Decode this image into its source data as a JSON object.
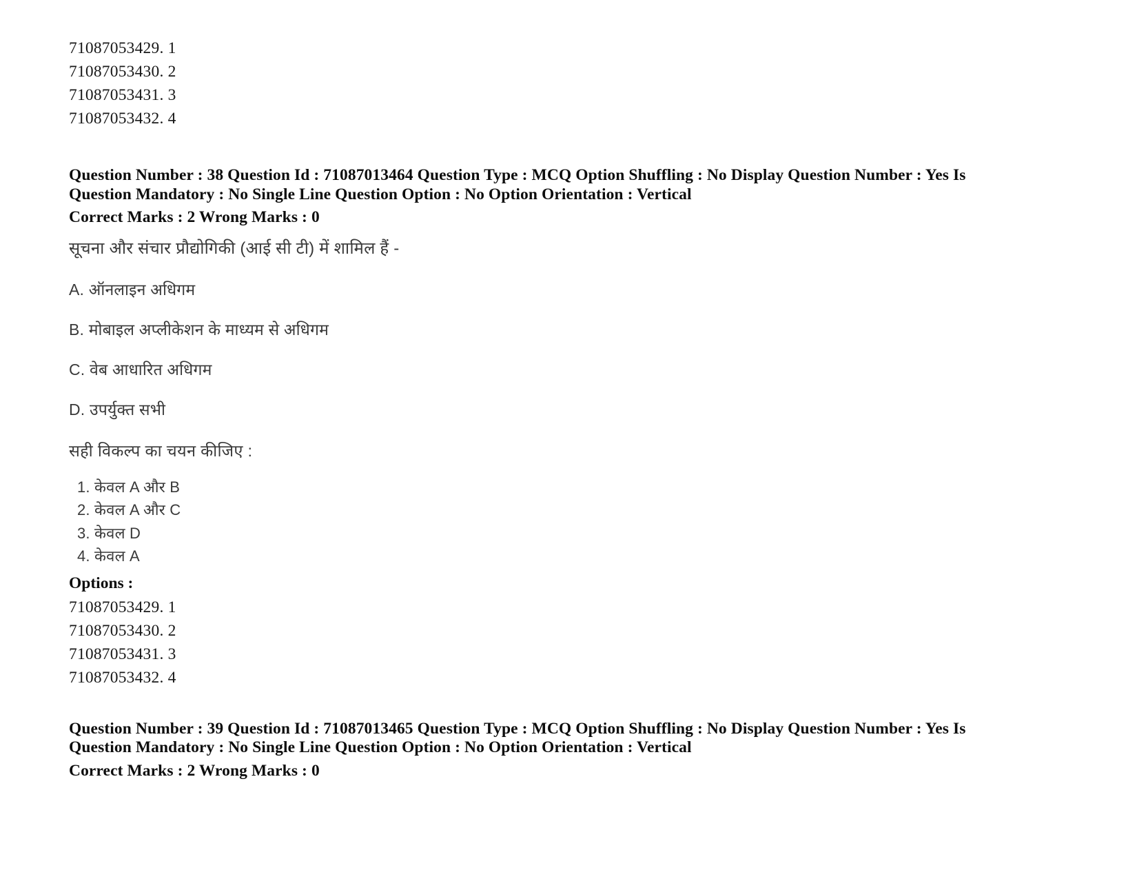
{
  "page": {
    "background_color": "#ffffff",
    "text_color": "#000000"
  },
  "top_option_ids": [
    "71087053429. 1",
    "71087053430. 2",
    "71087053431. 3",
    "71087053432. 4"
  ],
  "question_38": {
    "meta_line_1": "Question Number : 38 Question Id : 71087013464 Question Type : MCQ Option Shuffling : No Display Question Number : Yes Is",
    "meta_line_2": "Question Mandatory : No Single Line Question Option : No Option Orientation : Vertical",
    "marks_line": "Correct Marks : 2 Wrong Marks : 0",
    "stem": "सूचना और संचार प्रौद्योगिकी (आई सी टी) में शामिल हैं -",
    "alternatives": [
      "A. ऑनलाइन अधिगम",
      "B. मोबाइल अप्लीकेशन के माध्यम से अधिगम",
      "C. वेब आधारित अधिगम",
      "D. उपर्युक्त सभी"
    ],
    "select_instruction": "सही विकल्प का चयन कीजिए :",
    "choices": [
      "1. केवल A और B",
      "2. केवल A और C",
      "3. केवल D",
      "4. केवल A"
    ],
    "options_label": "Options :",
    "option_ids": [
      "71087053429. 1",
      "71087053430. 2",
      "71087053431. 3",
      "71087053432. 4"
    ]
  },
  "question_39": {
    "meta_line_1": "Question Number : 39 Question Id : 71087013465 Question Type : MCQ Option Shuffling : No Display Question Number : Yes Is",
    "meta_line_2": "Question Mandatory : No Single Line Question Option : No Option Orientation : Vertical",
    "marks_line": "Correct Marks : 2 Wrong Marks : 0"
  }
}
